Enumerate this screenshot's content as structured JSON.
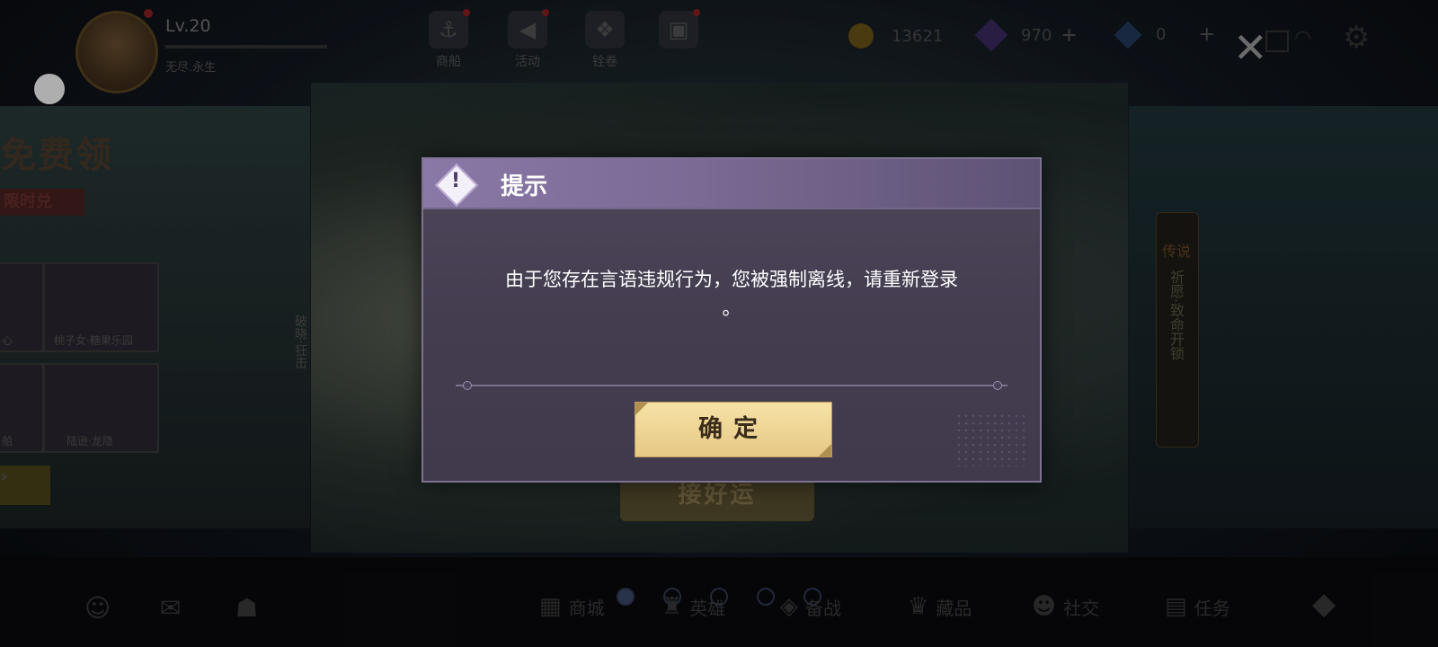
{
  "player": {
    "level": "Lv.20",
    "name": "无尽.永生"
  },
  "topnav": [
    {
      "label": "商船",
      "icon": "ship-icon",
      "glyph": "⚓"
    },
    {
      "label": "活动",
      "icon": "megaphone-icon",
      "glyph": "📣"
    },
    {
      "label": "铨卷",
      "icon": "scroll-icon",
      "glyph": "❖"
    },
    {
      "label": "",
      "icon": "gift-box-icon",
      "glyph": "▣"
    }
  ],
  "currencies": {
    "gold": "13621",
    "diamonds": "970",
    "tickets": "0"
  },
  "left_panel": {
    "title": "免费领",
    "subtitle": "限时兑",
    "thumb_labels": [
      "心",
      "桃子女·糖果乐园",
      "船",
      "陆逊·龙隐"
    ],
    "vertical_text": "破晓·狂击"
  },
  "center_banner": {
    "button_label": "接好运"
  },
  "right_panel": {
    "badge_label": "传说",
    "vertical_text": "祈愿·致命开锁"
  },
  "bottom_nav": [
    {
      "label": "商城",
      "icon": "shop-icon"
    },
    {
      "label": "英雄",
      "icon": "hero-icon"
    },
    {
      "label": "备战",
      "icon": "prepare-icon"
    },
    {
      "label": "藏品",
      "icon": "collection-icon"
    },
    {
      "label": "社交",
      "icon": "social-icon"
    },
    {
      "label": "任务",
      "icon": "task-icon"
    }
  ],
  "carousel": {
    "count": 5,
    "active_index": 0
  },
  "dialog": {
    "title": "提示",
    "message_line1": "由于您存在言语违规行为，您被强制离线，请重新登录",
    "message_line2": "。",
    "confirm_label": "确定"
  },
  "colors": {
    "dialog_bg": "#4a4256",
    "header": "#8a78a6",
    "confirm_bg": "#f0d89a"
  }
}
